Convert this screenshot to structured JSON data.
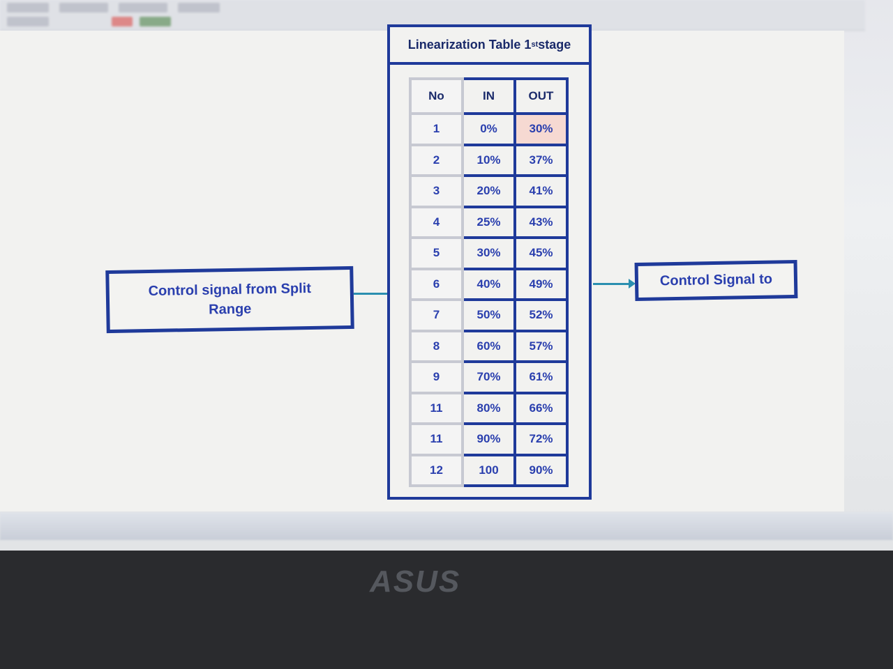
{
  "table": {
    "title": "Linearization Table 1",
    "title_sup": "st",
    "title_end": " stage",
    "headers": [
      "No",
      "IN",
      "OUT"
    ],
    "rows": [
      [
        "1",
        "0%",
        "30%"
      ],
      [
        "2",
        "10%",
        "37%"
      ],
      [
        "3",
        "20%",
        "41%"
      ],
      [
        "4",
        "25%",
        "43%"
      ],
      [
        "5",
        "30%",
        "45%"
      ],
      [
        "6",
        "40%",
        "49%"
      ],
      [
        "7",
        "50%",
        "52%"
      ],
      [
        "8",
        "60%",
        "57%"
      ],
      [
        "9",
        "70%",
        "61%"
      ],
      [
        "11",
        "80%",
        "66%"
      ],
      [
        "11",
        "90%",
        "72%"
      ],
      [
        "12",
        "100",
        "90%"
      ]
    ],
    "highlight_color": "#f6d9d2",
    "border_color": "#1f3a9a"
  },
  "left_box": {
    "line1": "Control signal from Split",
    "line2": "Range"
  },
  "right_box": {
    "label": "Control Signal to"
  },
  "laptop": {
    "brand": "ASUS"
  }
}
